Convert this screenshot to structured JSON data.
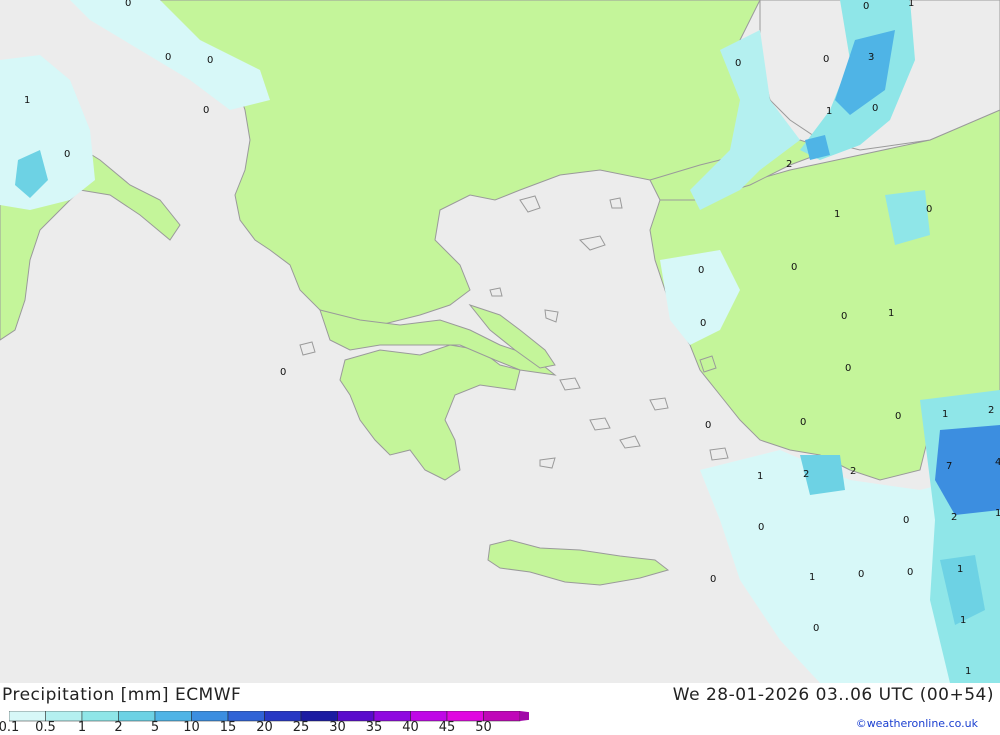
{
  "header": {
    "title": "Precipitation [mm] ECMWF",
    "datetime": "We 28-01-2026 03..06 UTC (00+54)"
  },
  "credit": "©weatheronline.co.uk",
  "legend": {
    "ticks": [
      "0.1",
      "0.5",
      "1",
      "2",
      "5",
      "10",
      "15",
      "20",
      "25",
      "30",
      "35",
      "40",
      "45",
      "50"
    ],
    "colors": [
      "#d7f8f8",
      "#b4f0f0",
      "#8fe6e8",
      "#6dd2e4",
      "#4fb4e6",
      "#3c8ee0",
      "#3063d6",
      "#2738c4",
      "#1c1ca2",
      "#5a0ccc",
      "#8f0ae0",
      "#bf08e6",
      "#e008e0",
      "#c008b8"
    ]
  },
  "map_colors": {
    "sea": "#ececec",
    "land": "#c4f59a",
    "coast": "#9a9a9a"
  },
  "map_values": [
    {
      "id": "v1",
      "text": "0"
    },
    {
      "id": "v2",
      "text": "0"
    },
    {
      "id": "v3",
      "text": "0"
    },
    {
      "id": "v4",
      "text": "0"
    },
    {
      "id": "v5",
      "text": "1"
    },
    {
      "id": "v6",
      "text": "0"
    },
    {
      "id": "v7",
      "text": "0"
    },
    {
      "id": "v8",
      "text": "0"
    },
    {
      "id": "v9",
      "text": "1"
    },
    {
      "id": "v10",
      "text": "0"
    },
    {
      "id": "v11",
      "text": "0"
    },
    {
      "id": "v12",
      "text": "3"
    },
    {
      "id": "v13",
      "text": "0"
    },
    {
      "id": "v14",
      "text": "1"
    },
    {
      "id": "v15",
      "text": "0"
    },
    {
      "id": "v16",
      "text": "2"
    },
    {
      "id": "v17",
      "text": "1"
    },
    {
      "id": "v18",
      "text": "0"
    },
    {
      "id": "v19",
      "text": "0"
    },
    {
      "id": "v20",
      "text": "0"
    },
    {
      "id": "v21",
      "text": "1"
    },
    {
      "id": "v22",
      "text": "0"
    },
    {
      "id": "v23",
      "text": "0"
    },
    {
      "id": "v24",
      "text": "0"
    },
    {
      "id": "v25",
      "text": "0"
    },
    {
      "id": "v26",
      "text": "0"
    },
    {
      "id": "v27",
      "text": "0"
    },
    {
      "id": "v28",
      "text": "1"
    },
    {
      "id": "v29",
      "text": "2"
    },
    {
      "id": "v30",
      "text": "7"
    },
    {
      "id": "v31",
      "text": "4"
    },
    {
      "id": "v32",
      "text": "2"
    },
    {
      "id": "v33",
      "text": "2"
    },
    {
      "id": "v34",
      "text": "1"
    },
    {
      "id": "v35",
      "text": "0"
    },
    {
      "id": "v36",
      "text": "2"
    },
    {
      "id": "v37",
      "text": "0"
    },
    {
      "id": "v38",
      "text": "1"
    },
    {
      "id": "v39",
      "text": "0"
    },
    {
      "id": "v40",
      "text": "0"
    },
    {
      "id": "v41",
      "text": "1"
    },
    {
      "id": "v42",
      "text": "0"
    },
    {
      "id": "v43",
      "text": "1"
    },
    {
      "id": "v44",
      "text": "1"
    },
    {
      "id": "v45",
      "text": "1"
    }
  ]
}
